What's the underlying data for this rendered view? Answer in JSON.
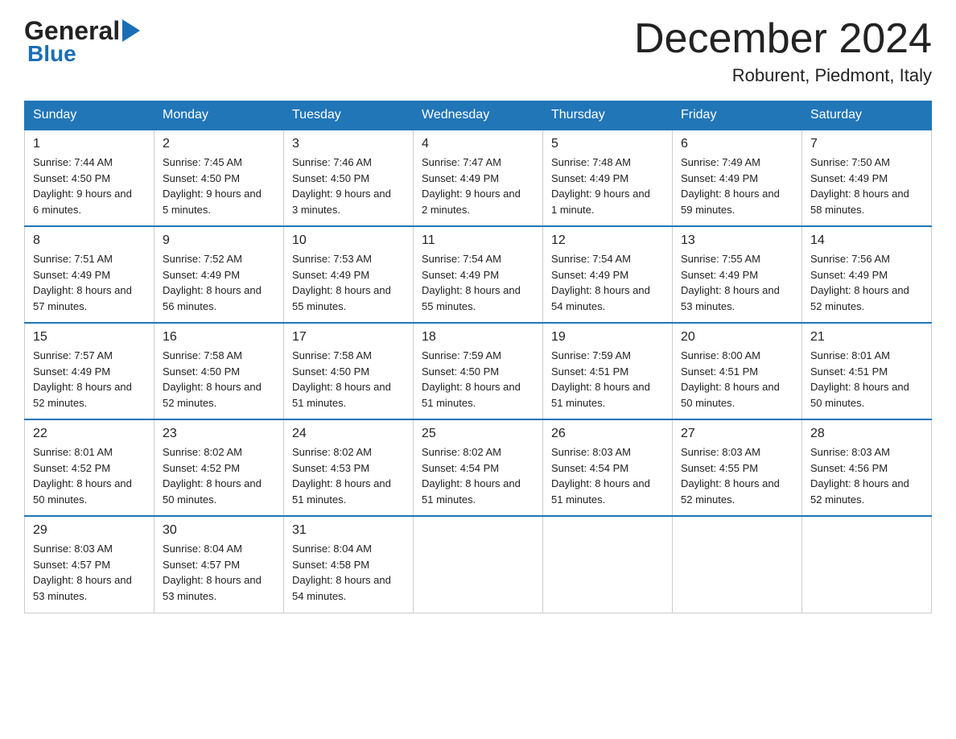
{
  "header": {
    "month_title": "December 2024",
    "location": "Roburent, Piedmont, Italy",
    "logo_general": "General",
    "logo_blue": "Blue"
  },
  "days_of_week": [
    "Sunday",
    "Monday",
    "Tuesday",
    "Wednesday",
    "Thursday",
    "Friday",
    "Saturday"
  ],
  "weeks": [
    [
      {
        "day": "1",
        "sunrise": "7:44 AM",
        "sunset": "4:50 PM",
        "daylight": "9 hours and 6 minutes."
      },
      {
        "day": "2",
        "sunrise": "7:45 AM",
        "sunset": "4:50 PM",
        "daylight": "9 hours and 5 minutes."
      },
      {
        "day": "3",
        "sunrise": "7:46 AM",
        "sunset": "4:50 PM",
        "daylight": "9 hours and 3 minutes."
      },
      {
        "day": "4",
        "sunrise": "7:47 AM",
        "sunset": "4:49 PM",
        "daylight": "9 hours and 2 minutes."
      },
      {
        "day": "5",
        "sunrise": "7:48 AM",
        "sunset": "4:49 PM",
        "daylight": "9 hours and 1 minute."
      },
      {
        "day": "6",
        "sunrise": "7:49 AM",
        "sunset": "4:49 PM",
        "daylight": "8 hours and 59 minutes."
      },
      {
        "day": "7",
        "sunrise": "7:50 AM",
        "sunset": "4:49 PM",
        "daylight": "8 hours and 58 minutes."
      }
    ],
    [
      {
        "day": "8",
        "sunrise": "7:51 AM",
        "sunset": "4:49 PM",
        "daylight": "8 hours and 57 minutes."
      },
      {
        "day": "9",
        "sunrise": "7:52 AM",
        "sunset": "4:49 PM",
        "daylight": "8 hours and 56 minutes."
      },
      {
        "day": "10",
        "sunrise": "7:53 AM",
        "sunset": "4:49 PM",
        "daylight": "8 hours and 55 minutes."
      },
      {
        "day": "11",
        "sunrise": "7:54 AM",
        "sunset": "4:49 PM",
        "daylight": "8 hours and 55 minutes."
      },
      {
        "day": "12",
        "sunrise": "7:54 AM",
        "sunset": "4:49 PM",
        "daylight": "8 hours and 54 minutes."
      },
      {
        "day": "13",
        "sunrise": "7:55 AM",
        "sunset": "4:49 PM",
        "daylight": "8 hours and 53 minutes."
      },
      {
        "day": "14",
        "sunrise": "7:56 AM",
        "sunset": "4:49 PM",
        "daylight": "8 hours and 52 minutes."
      }
    ],
    [
      {
        "day": "15",
        "sunrise": "7:57 AM",
        "sunset": "4:49 PM",
        "daylight": "8 hours and 52 minutes."
      },
      {
        "day": "16",
        "sunrise": "7:58 AM",
        "sunset": "4:50 PM",
        "daylight": "8 hours and 52 minutes."
      },
      {
        "day": "17",
        "sunrise": "7:58 AM",
        "sunset": "4:50 PM",
        "daylight": "8 hours and 51 minutes."
      },
      {
        "day": "18",
        "sunrise": "7:59 AM",
        "sunset": "4:50 PM",
        "daylight": "8 hours and 51 minutes."
      },
      {
        "day": "19",
        "sunrise": "7:59 AM",
        "sunset": "4:51 PM",
        "daylight": "8 hours and 51 minutes."
      },
      {
        "day": "20",
        "sunrise": "8:00 AM",
        "sunset": "4:51 PM",
        "daylight": "8 hours and 50 minutes."
      },
      {
        "day": "21",
        "sunrise": "8:01 AM",
        "sunset": "4:51 PM",
        "daylight": "8 hours and 50 minutes."
      }
    ],
    [
      {
        "day": "22",
        "sunrise": "8:01 AM",
        "sunset": "4:52 PM",
        "daylight": "8 hours and 50 minutes."
      },
      {
        "day": "23",
        "sunrise": "8:02 AM",
        "sunset": "4:52 PM",
        "daylight": "8 hours and 50 minutes."
      },
      {
        "day": "24",
        "sunrise": "8:02 AM",
        "sunset": "4:53 PM",
        "daylight": "8 hours and 51 minutes."
      },
      {
        "day": "25",
        "sunrise": "8:02 AM",
        "sunset": "4:54 PM",
        "daylight": "8 hours and 51 minutes."
      },
      {
        "day": "26",
        "sunrise": "8:03 AM",
        "sunset": "4:54 PM",
        "daylight": "8 hours and 51 minutes."
      },
      {
        "day": "27",
        "sunrise": "8:03 AM",
        "sunset": "4:55 PM",
        "daylight": "8 hours and 52 minutes."
      },
      {
        "day": "28",
        "sunrise": "8:03 AM",
        "sunset": "4:56 PM",
        "daylight": "8 hours and 52 minutes."
      }
    ],
    [
      {
        "day": "29",
        "sunrise": "8:03 AM",
        "sunset": "4:57 PM",
        "daylight": "8 hours and 53 minutes."
      },
      {
        "day": "30",
        "sunrise": "8:04 AM",
        "sunset": "4:57 PM",
        "daylight": "8 hours and 53 minutes."
      },
      {
        "day": "31",
        "sunrise": "8:04 AM",
        "sunset": "4:58 PM",
        "daylight": "8 hours and 54 minutes."
      },
      null,
      null,
      null,
      null
    ]
  ]
}
